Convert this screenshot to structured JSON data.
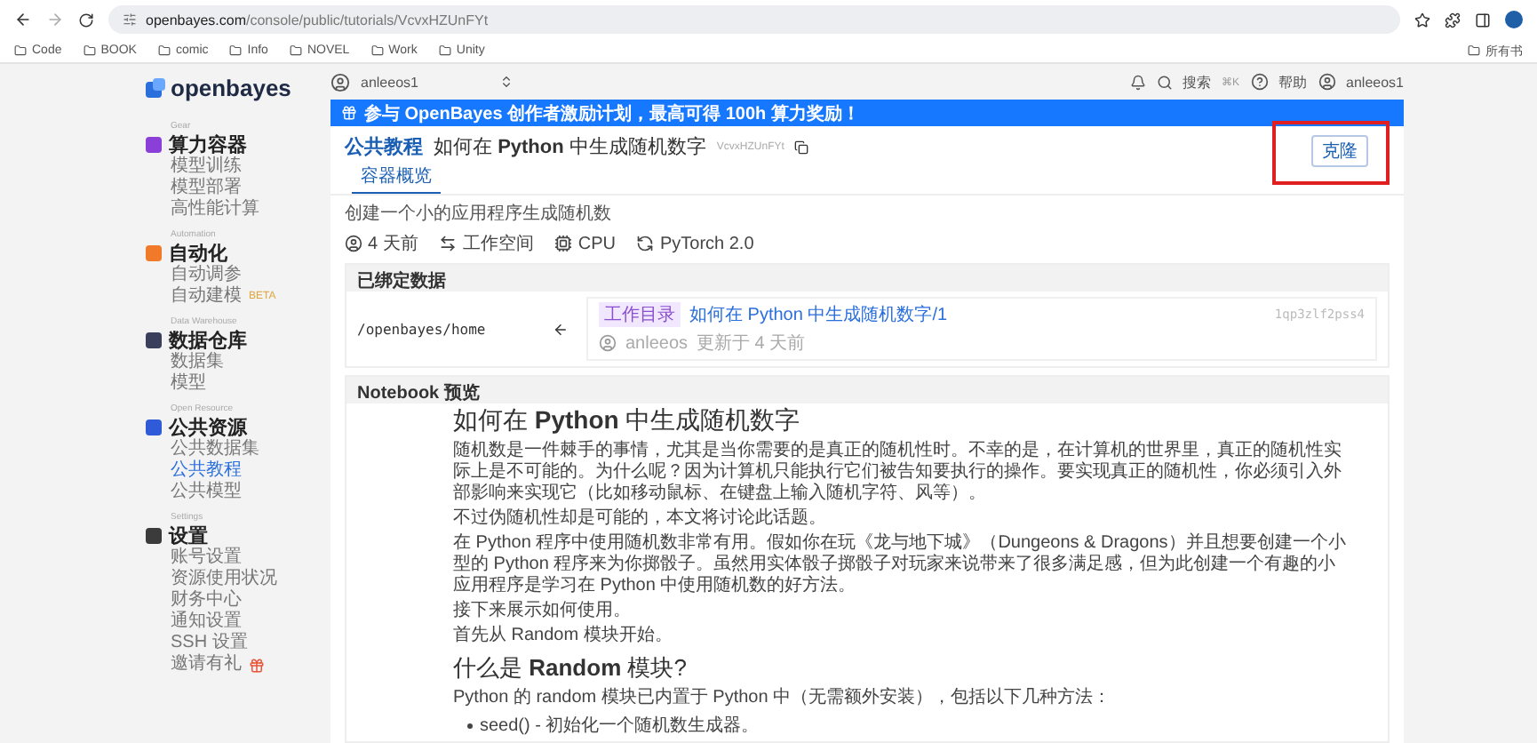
{
  "browser": {
    "url_host": "openbayes.com",
    "url_path": "/console/public/tutorials/VcvxHZUnFYt",
    "bookmarks": [
      "Code",
      "BOOK",
      "comic",
      "Info",
      "NOVEL",
      "Work",
      "Unity"
    ],
    "all_bookmarks": "所有书"
  },
  "sidebar": {
    "logo": "openbayes",
    "groups": [
      {
        "label": "Gear",
        "title": "算力容器",
        "color": "#8b3fd9",
        "items": [
          {
            "text": "模型训练",
            "selected": false
          },
          {
            "text": "模型部署",
            "selected": false
          },
          {
            "text": "高性能计算",
            "selected": false
          }
        ]
      },
      {
        "label": "Automation",
        "title": "自动化",
        "color": "#f07a2a",
        "items": [
          {
            "text": "自动调参",
            "selected": false
          },
          {
            "text": "自动建模",
            "selected": false,
            "badge": "BETA"
          }
        ]
      },
      {
        "label": "Data Warehouse",
        "title": "数据仓库",
        "color": "#3a3f5c",
        "items": [
          {
            "text": "数据集",
            "selected": false
          },
          {
            "text": "模型",
            "selected": false
          }
        ]
      },
      {
        "label": "Open Resource",
        "title": "公共资源",
        "color": "#2f5bd8",
        "items": [
          {
            "text": "公共数据集",
            "selected": false
          },
          {
            "text": "公共教程",
            "selected": true
          },
          {
            "text": "公共模型",
            "selected": false
          }
        ]
      },
      {
        "label": "Settings",
        "title": "设置",
        "color": "#3b3b3b",
        "items": [
          {
            "text": "账号设置",
            "selected": false
          },
          {
            "text": "资源使用状况",
            "selected": false
          },
          {
            "text": "财务中心",
            "selected": false
          },
          {
            "text": "通知设置",
            "selected": false
          },
          {
            "text": "SSH 设置",
            "selected": false
          },
          {
            "text": "邀请有礼",
            "selected": false,
            "gift": true
          }
        ]
      }
    ]
  },
  "topbar": {
    "workspace": "anleeos1",
    "search": "搜索",
    "shortcut": "⌘K",
    "help": "帮助",
    "user": "anleeos1"
  },
  "banner": "参与 OpenBayes 创作者激励计划，最高可得 100h 算力奖励！",
  "header": {
    "crumb": "公共教程",
    "title": "如何在 **Python** 中生成随机数字",
    "id": "VcvxHZUnFYt",
    "clone": "克隆",
    "tabs": [
      {
        "label": "容器概览",
        "selected": true
      }
    ]
  },
  "description": "创建一个小的应用程序生成随机数",
  "meta": [
    {
      "kind": "time",
      "text": "4 天前"
    },
    {
      "kind": "workspace",
      "text": "工作空间"
    },
    {
      "kind": "cpu",
      "text": "CPU"
    },
    {
      "kind": "framework",
      "text": "PyTorch 2.0"
    }
  ],
  "bound_data": {
    "title": "已绑定数据",
    "path": "/openbayes/home",
    "tag": "工作目录",
    "link": "如何在 Python 中生成随机数字/1",
    "hash": "1qp3zlf2pss4",
    "user": "anleeos",
    "updated": "更新于 4 天前"
  },
  "notebook": {
    "title": "Notebook 预览",
    "blocks": [
      {
        "kind": "h1",
        "text": "如何在 **Python** 中生成随机数字"
      },
      {
        "kind": "p",
        "text": "随机数是一件棘手的事情，尤其是当你需要的是真正的随机性时。不幸的是，在计算机的世界里，真正的随机性实际上是不可能的。为什么呢？因为计算机只能执行它们被告知要执行的操作。要实现真正的随机性，你必须引入外部影响来实现它（比如移动鼠标、在键盘上输入随机字符、风等）。"
      },
      {
        "kind": "p",
        "text": "不过伪随机性却是可能的，本文将讨论此话题。"
      },
      {
        "kind": "p",
        "text": "在 Python 程序中使用随机数非常有用。假如你在玩《龙与地下城》（Dungeons & Dragons）并且想要创建一个小型的 Python 程序来为你掷骰子。虽然用实体骰子掷骰子对玩家来说带来了很多满足感，但为此创建一个有趣的小应用程序是学习在 Python 中使用随机数的好方法。"
      },
      {
        "kind": "p",
        "text": "接下来展示如何使用。"
      },
      {
        "kind": "p",
        "text": "首先从 Random 模块开始。"
      },
      {
        "kind": "h2",
        "text": "什么是 **Random** 模块?"
      },
      {
        "kind": "p",
        "text": "Python 的 random 模块已内置于 Python 中（无需额外安装），包括以下几种方法："
      },
      {
        "kind": "li",
        "text": "seed() - 初始化一个随机数生成器。"
      }
    ]
  }
}
